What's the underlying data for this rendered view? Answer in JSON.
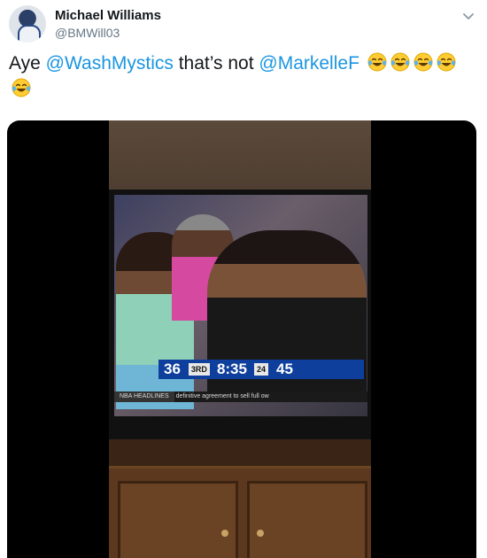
{
  "tweet": {
    "author_name": "Michael Williams",
    "author_handle": "@BMWill03",
    "text_prefix": "Aye ",
    "mention_1": "@WashMystics",
    "text_middle": " that’s not ",
    "mention_2": "@MarkelleF",
    "emojis": [
      "face-with-tears-of-joy",
      "face-with-tears-of-joy",
      "face-with-tears-of-joy",
      "face-with-tears-of-joy",
      "face-with-tears-of-joy"
    ]
  },
  "video": {
    "scorebug": {
      "left_score": "36",
      "period": "3RD",
      "clock": "8:35",
      "shot_clock": "24",
      "right_score": "45"
    },
    "ticker": {
      "tag": "NBA HEADLINES",
      "text": "definitive agreement to sell full ow"
    }
  },
  "colors": {
    "mention": "#1b95e0",
    "scorebug": "#0f3f9d"
  }
}
